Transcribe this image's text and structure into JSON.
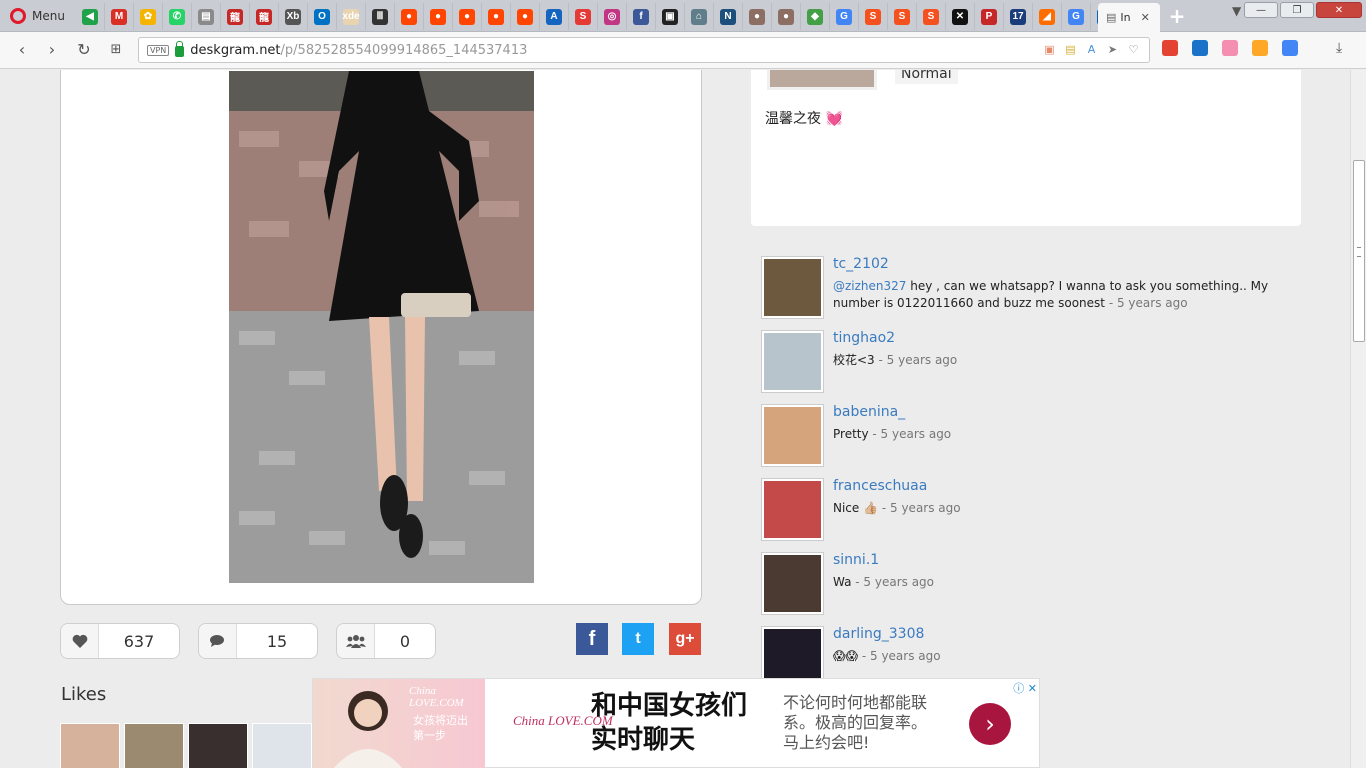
{
  "browser": {
    "menu_label": "Menu",
    "active_tab_label": "In",
    "tab_close": "✕",
    "new_tab": "+",
    "url_host": "deskgram.net",
    "url_path": "/p/582528554099914865_144537413",
    "vpn_label": "VPN",
    "tabs": [
      {
        "icon": "arrow-icon",
        "glyph": "◀",
        "color": "#1fa24a"
      },
      {
        "icon": "gmail-icon",
        "glyph": "M",
        "color": "#d93025"
      },
      {
        "icon": "photos-icon",
        "glyph": "✿",
        "color": "#f4b400"
      },
      {
        "icon": "whatsapp-icon",
        "glyph": "✆",
        "color": "#25d366"
      },
      {
        "icon": "page-icon",
        "glyph": "▤",
        "color": "#8a8a8a"
      },
      {
        "icon": "red-logo-icon",
        "glyph": "龍",
        "color": "#c62828"
      },
      {
        "icon": "red-logo-icon",
        "glyph": "龍",
        "color": "#c62828"
      },
      {
        "icon": "xb-icon",
        "glyph": "Xb",
        "color": "#555555"
      },
      {
        "icon": "outlook-icon",
        "glyph": "O",
        "color": "#0072c6"
      },
      {
        "icon": "xde-icon",
        "glyph": "xde",
        "color": "#e8d5b0"
      },
      {
        "icon": "bars-icon",
        "glyph": "Ⅲ",
        "color": "#333333"
      },
      {
        "icon": "reddit-icon",
        "glyph": "●",
        "color": "#ff4500"
      },
      {
        "icon": "reddit-icon",
        "glyph": "●",
        "color": "#ff4500"
      },
      {
        "icon": "reddit-icon",
        "glyph": "●",
        "color": "#ff4500"
      },
      {
        "icon": "reddit-icon",
        "glyph": "●",
        "color": "#ff4500"
      },
      {
        "icon": "reddit-icon",
        "glyph": "●",
        "color": "#ff4500"
      },
      {
        "icon": "book-icon",
        "glyph": "A",
        "color": "#1565c0"
      },
      {
        "icon": "s-logo-icon",
        "glyph": "S",
        "color": "#e53935"
      },
      {
        "icon": "instagram-icon",
        "glyph": "◎",
        "color": "#c13584"
      },
      {
        "icon": "facebook-icon",
        "glyph": "f",
        "color": "#3b5998"
      },
      {
        "icon": "clapper-icon",
        "glyph": "▣",
        "color": "#222222"
      },
      {
        "icon": "home-icon",
        "glyph": "⌂",
        "color": "#607d8b"
      },
      {
        "icon": "n-logo-icon",
        "glyph": "N",
        "color": "#1c4f7c"
      },
      {
        "icon": "hedgehog-icon",
        "glyph": "●",
        "color": "#8d6e63"
      },
      {
        "icon": "hedgehog-icon",
        "glyph": "●",
        "color": "#8d6e63"
      },
      {
        "icon": "map-icon",
        "glyph": "◆",
        "color": "#43a047"
      },
      {
        "icon": "google-icon",
        "glyph": "G",
        "color": "#4285f4"
      },
      {
        "icon": "shop-icon",
        "glyph": "S",
        "color": "#f4511e"
      },
      {
        "icon": "shop-icon",
        "glyph": "S",
        "color": "#f4511e"
      },
      {
        "icon": "shop-icon",
        "glyph": "S",
        "color": "#f4511e"
      },
      {
        "icon": "x-logo-icon",
        "glyph": "✕",
        "color": "#111111"
      },
      {
        "icon": "p-logo-icon",
        "glyph": "P",
        "color": "#c62828"
      },
      {
        "icon": "calendar-icon",
        "glyph": "17",
        "color": "#1a3d7c"
      },
      {
        "icon": "orange-icon",
        "glyph": "◢",
        "color": "#ff6d00"
      },
      {
        "icon": "google-icon",
        "glyph": "G",
        "color": "#4285f4"
      },
      {
        "icon": "onedrive-icon",
        "glyph": "☁",
        "color": "#0364b8"
      }
    ],
    "ext_icons": [
      {
        "icon": "todoist-icon",
        "color": "#e44332"
      },
      {
        "icon": "s-ext-icon",
        "color": "#1a73c8"
      },
      {
        "icon": "mask-icon",
        "color": "#f48fb1"
      },
      {
        "icon": "diamond-ext-icon",
        "color": "#ffa726"
      },
      {
        "icon": "translate-icon",
        "color": "#4285f4"
      }
    ]
  },
  "post": {
    "likes_count": "637",
    "comments_count": "15",
    "tagged_count": "0",
    "likes_title": "Likes",
    "filter": "Normal",
    "caption": "温馨之夜 💓",
    "share": {
      "facebook": "f",
      "twitter": "t",
      "googleplus": "g+"
    }
  },
  "comments": [
    {
      "user": "tc_2102",
      "mention": "@zizhen327",
      "text": " hey , can we whatsapp? I wanna to ask you something.. My number is 0122011660 and buzz me soonest",
      "ago": " - 5 years ago",
      "avatar_color": "#6d5a3e"
    },
    {
      "user": "tinghao2",
      "mention": "",
      "text": "校花<3",
      "ago": " - 5 years ago",
      "avatar_color": "#b8c4cc"
    },
    {
      "user": "babenina_",
      "mention": "",
      "text": "Pretty",
      "ago": " - 5 years ago",
      "avatar_color": "#d6a47c"
    },
    {
      "user": "franceschuaa",
      "mention": "",
      "text": "Nice 👍🏼",
      "ago": " - 5 years ago",
      "avatar_color": "#c44a4a"
    },
    {
      "user": "sinni.1",
      "mention": "",
      "text": "Wa",
      "ago": " - 5 years ago",
      "avatar_color": "#4a3a32"
    },
    {
      "user": "darling_3308",
      "mention": "",
      "text": "😱😱",
      "ago": " - 5 years ago",
      "avatar_color": "#1e1a28"
    }
  ],
  "ad": {
    "brand": "China LOVE.COM",
    "slogan_line1": "女孩将迈出",
    "slogan_line2": "第一步",
    "logo": "China LOVE.COM",
    "headline": "和中国女孩们实时聊天",
    "body": "不论何时何地都能联系。极高的回复率。马上约会吧!",
    "cta": "›",
    "close": "ⓘ ✕"
  }
}
